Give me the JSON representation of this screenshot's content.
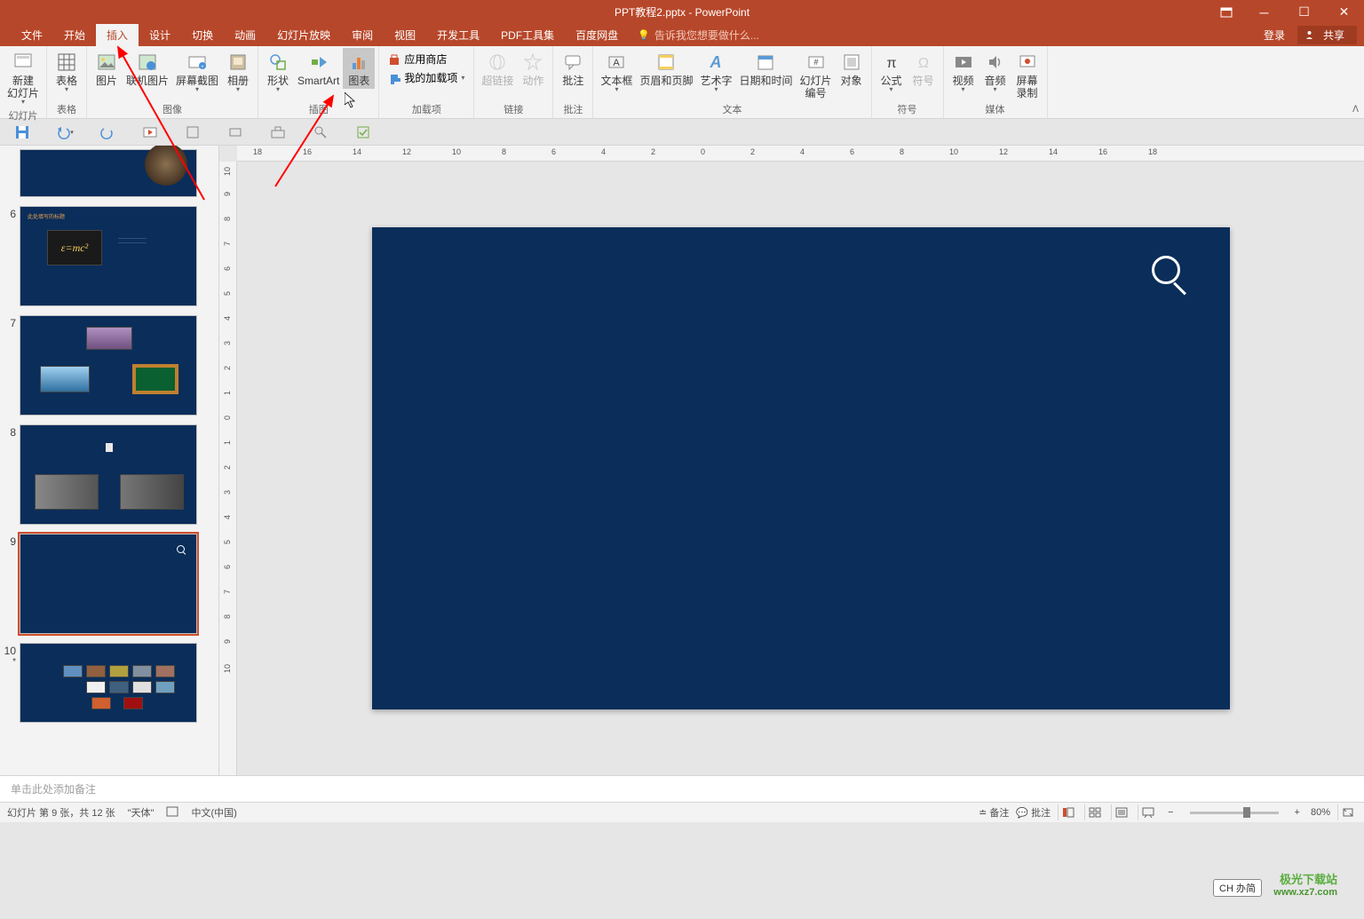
{
  "title": "PPT教程2.pptx - PowerPoint",
  "tabs": {
    "file": "文件",
    "home": "开始",
    "insert": "插入",
    "design": "设计",
    "transitions": "切换",
    "animations": "动画",
    "slideshow": "幻灯片放映",
    "review": "审阅",
    "view": "视图",
    "developer": "开发工具",
    "pdftools": "PDF工具集",
    "baidupan": "百度网盘",
    "help_placeholder": "告诉我您想要做什么...",
    "login": "登录",
    "share": "共享"
  },
  "ribbon": {
    "groups": {
      "slides": "幻灯片",
      "tables": "表格",
      "images": "图像",
      "illustrations": "插图",
      "addins": "加载项",
      "links": "链接",
      "comments": "批注",
      "text": "文本",
      "symbols": "符号",
      "media": "媒体"
    },
    "items": {
      "new_slide": "新建\n幻灯片",
      "table": "表格",
      "pictures": "图片",
      "online_pictures": "联机图片",
      "screenshot": "屏幕截图",
      "photo_album": "相册",
      "shapes": "形状",
      "smartart": "SmartArt",
      "chart": "图表",
      "app_store": "应用商店",
      "my_addins": "我的加载项",
      "hyperlink": "超链接",
      "action": "动作",
      "comment": "批注",
      "textbox": "文本框",
      "header_footer": "页眉和页脚",
      "wordart": "艺术字",
      "date_time": "日期和时间",
      "slide_number": "幻灯片\n编号",
      "object": "对象",
      "equation": "公式",
      "symbol": "符号",
      "video": "视频",
      "audio": "音频",
      "screen_recording": "屏幕\n录制"
    }
  },
  "thumbnails": {
    "visible_numbers": [
      "6",
      "7",
      "8",
      "9",
      "10"
    ],
    "selected_index": 9,
    "asterisk_on_10": "*",
    "slide6_title": "此处填写的标题"
  },
  "notes_placeholder": "单击此处添加备注",
  "statusbar": {
    "slide_info": "幻灯片 第 9 张，共 12 张",
    "theme": "\"天体\"",
    "language": "中文(中国)",
    "notes_btn": "备注",
    "comments_btn": "批注",
    "zoom": "80%",
    "ime": "CH 办简"
  },
  "ruler": {
    "h_labels": [
      "18",
      "",
      "16",
      "",
      "14",
      "",
      "12",
      "",
      "10",
      "",
      "8",
      "",
      "6",
      "",
      "4",
      "",
      "2",
      "",
      "0",
      "",
      "2",
      "",
      "4",
      "",
      "6",
      "",
      "8",
      "",
      "10",
      "",
      "12",
      "",
      "14",
      "",
      "16",
      "",
      "18"
    ],
    "v_labels": [
      "10",
      "9",
      "8",
      "7",
      "6",
      "5",
      "4",
      "3",
      "2",
      "1",
      "0",
      "1",
      "2",
      "3",
      "4",
      "5",
      "6",
      "7",
      "8",
      "9",
      "10"
    ]
  },
  "watermark": {
    "brand": "极光下载站",
    "url": "www.xz7.com"
  }
}
